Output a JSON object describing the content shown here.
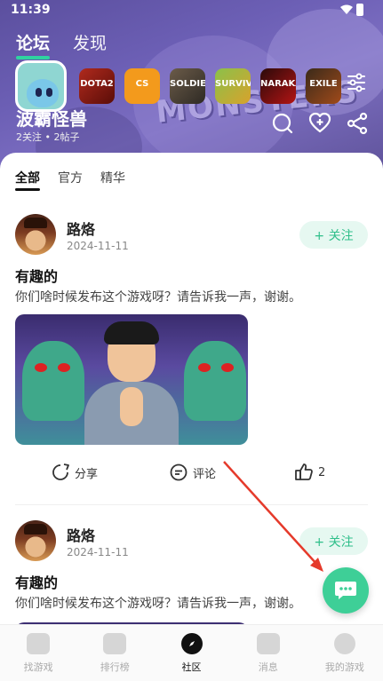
{
  "status_bar": {
    "time": "11:39"
  },
  "top_tabs": [
    {
      "label": "论坛",
      "active": true
    },
    {
      "label": "发现",
      "active": false
    }
  ],
  "games": [
    {
      "name": "DOTA2",
      "icon": "dota-icon"
    },
    {
      "name": "CS",
      "icon": "cs-icon"
    },
    {
      "name": "SOLDIER",
      "icon": "soldier-icon"
    },
    {
      "name": "SURVIVAL",
      "icon": "survival-icon"
    },
    {
      "name": "NARAKA",
      "icon": "naraka-icon"
    },
    {
      "name": "EXILE",
      "icon": "poe-icon"
    }
  ],
  "current_game": {
    "name": "波霸怪兽",
    "stats": "2关注 • 2帖子"
  },
  "sub_tabs": [
    {
      "label": "全部",
      "active": true
    },
    {
      "label": "官方",
      "active": false
    },
    {
      "label": "精华",
      "active": false
    }
  ],
  "posts": [
    {
      "author": "路烙",
      "date": "2024-11-11",
      "follow_label": "+ 关注",
      "title": "有趣的",
      "body": "你们啥时候发布这个游戏呀？请告诉我一声，谢谢。",
      "share_label": "分享",
      "comment_label": "评论",
      "likes": "2"
    },
    {
      "author": "路烙",
      "date": "2024-11-11",
      "follow_label": "+ 关注",
      "title": "有趣的",
      "body": "你们啥时候发布这个游戏呀？请告诉我一声，谢谢。"
    }
  ],
  "bottom_nav": [
    {
      "label": "找游戏",
      "active": false
    },
    {
      "label": "排行榜",
      "active": false
    },
    {
      "label": "社区",
      "active": true
    },
    {
      "label": "消息",
      "active": false
    },
    {
      "label": "我的游戏",
      "active": false
    }
  ],
  "colors": {
    "accent": "#3ecf97",
    "follow_bg": "#e6f8f1",
    "arrow": "#e53a2b"
  }
}
